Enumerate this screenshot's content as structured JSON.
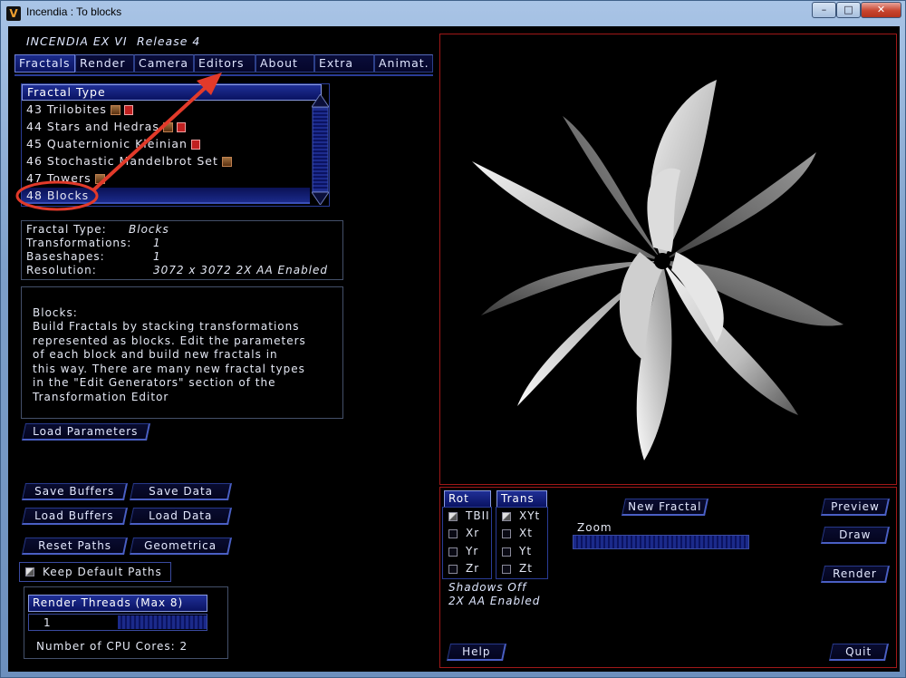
{
  "window": {
    "title": "Incendia :  To blocks",
    "controls": {
      "minimize": "–",
      "maximize": "□",
      "close": "✕"
    }
  },
  "header": {
    "title": "INCENDIA EX VI",
    "release": "Release 4"
  },
  "tabs": [
    "Fractals",
    "Render",
    "Camera",
    "Editors",
    "About",
    "Extra",
    "Animat."
  ],
  "fractal_list": {
    "header": "Fractal Type",
    "items": [
      {
        "label": "43 Trilobites",
        "icons": [
          "brown",
          "red"
        ]
      },
      {
        "label": "44 Stars and Hedras",
        "icons": [
          "brown",
          "red"
        ]
      },
      {
        "label": "45 Quaternionic Kleinian",
        "icons": [
          "red"
        ]
      },
      {
        "label": "46 Stochastic Mandelbrot Set",
        "icons": [
          "brown"
        ]
      },
      {
        "label": "47 Towers",
        "icons": [
          "brown"
        ]
      },
      {
        "label": "48 Blocks",
        "icons": [],
        "selected": true
      }
    ]
  },
  "info": {
    "type_label": "Fractal Type:",
    "type_value": "Blocks",
    "transformations_label": "Transformations:",
    "transformations_value": "1",
    "baseshapes_label": "Baseshapes:",
    "baseshapes_value": "1",
    "resolution_label": "Resolution:",
    "resolution_value": "3072 x 3072  2X AA Enabled"
  },
  "description": {
    "title": "Blocks:",
    "lines": [
      "Build Fractals by stacking transformations",
      "represented as blocks. Edit the parameters",
      "of each block  and build  new  fractals in",
      "this way. There are many new fractal types",
      "in the \"Edit Generators\" section  of the",
      "Transformation Editor"
    ]
  },
  "buttons": {
    "load_parameters": "Load Parameters",
    "save_buffers": "Save Buffers",
    "save_data": "Save Data",
    "load_buffers": "Load Buffers",
    "load_data": "Load Data",
    "reset_paths": "Reset Paths",
    "geometrica": "Geometrica",
    "keep_default_paths": "Keep Default Paths"
  },
  "threads": {
    "header": "Render Threads (Max 8)",
    "value": "1",
    "cpu_cores": "Number of CPU Cores: 2"
  },
  "controls": {
    "rot_tab": "Rot",
    "trans_tab": "Trans",
    "rot_items": [
      {
        "label": "TBII",
        "checked": true
      },
      {
        "label": "Xr",
        "checked": false
      },
      {
        "label": "Yr",
        "checked": false
      },
      {
        "label": "Zr",
        "checked": false
      }
    ],
    "trans_items": [
      {
        "label": "XYt",
        "checked": true
      },
      {
        "label": "Xt",
        "checked": false
      },
      {
        "label": "Yt",
        "checked": false
      },
      {
        "label": "Zt",
        "checked": false
      }
    ],
    "new_fractal": "New Fractal",
    "zoom_label": "Zoom",
    "preview": "Preview",
    "draw": "Draw",
    "render": "Render",
    "shadows": "Shadows Off",
    "aa": "2X AA Enabled",
    "help": "Help",
    "quit": "Quit"
  },
  "colors": {
    "accent": "#1f2f95",
    "viewport_border": "#a01818",
    "annotation": "#e23a2a"
  }
}
